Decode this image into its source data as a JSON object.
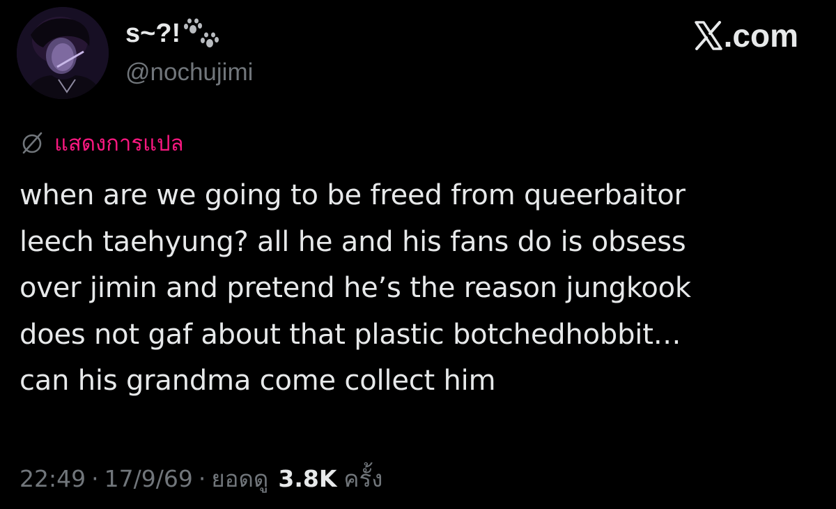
{
  "header": {
    "display_name": "s~?!",
    "handle": "@nochujimi",
    "brand": ".com",
    "icons": {
      "avatar": "profile-photo",
      "name_emoji": "paw-prints-icon",
      "brand_logo": "x-logo-icon"
    }
  },
  "translate": {
    "icon": "globe-slash-icon",
    "label": "แสดงการแปล"
  },
  "tweet": {
    "lines": [
      "when are we going to be freed from queerbaitor",
      "leech taehyung? all he and his fans do is obsess",
      "over jimin and pretend he’s the reason jungkook",
      "does not gaf about that plastic botchedhobbit…",
      "can his grandma come collect him"
    ]
  },
  "meta": {
    "time": "22:49",
    "separator": "·",
    "date": "17/9/69",
    "views_label": "ยอดดู",
    "views_count": "3.8K",
    "views_suffix": "ครั้ง"
  },
  "colors": {
    "background": "#000000",
    "text": "#e7e9ea",
    "muted": "#71767b",
    "accent": "#f91880"
  }
}
